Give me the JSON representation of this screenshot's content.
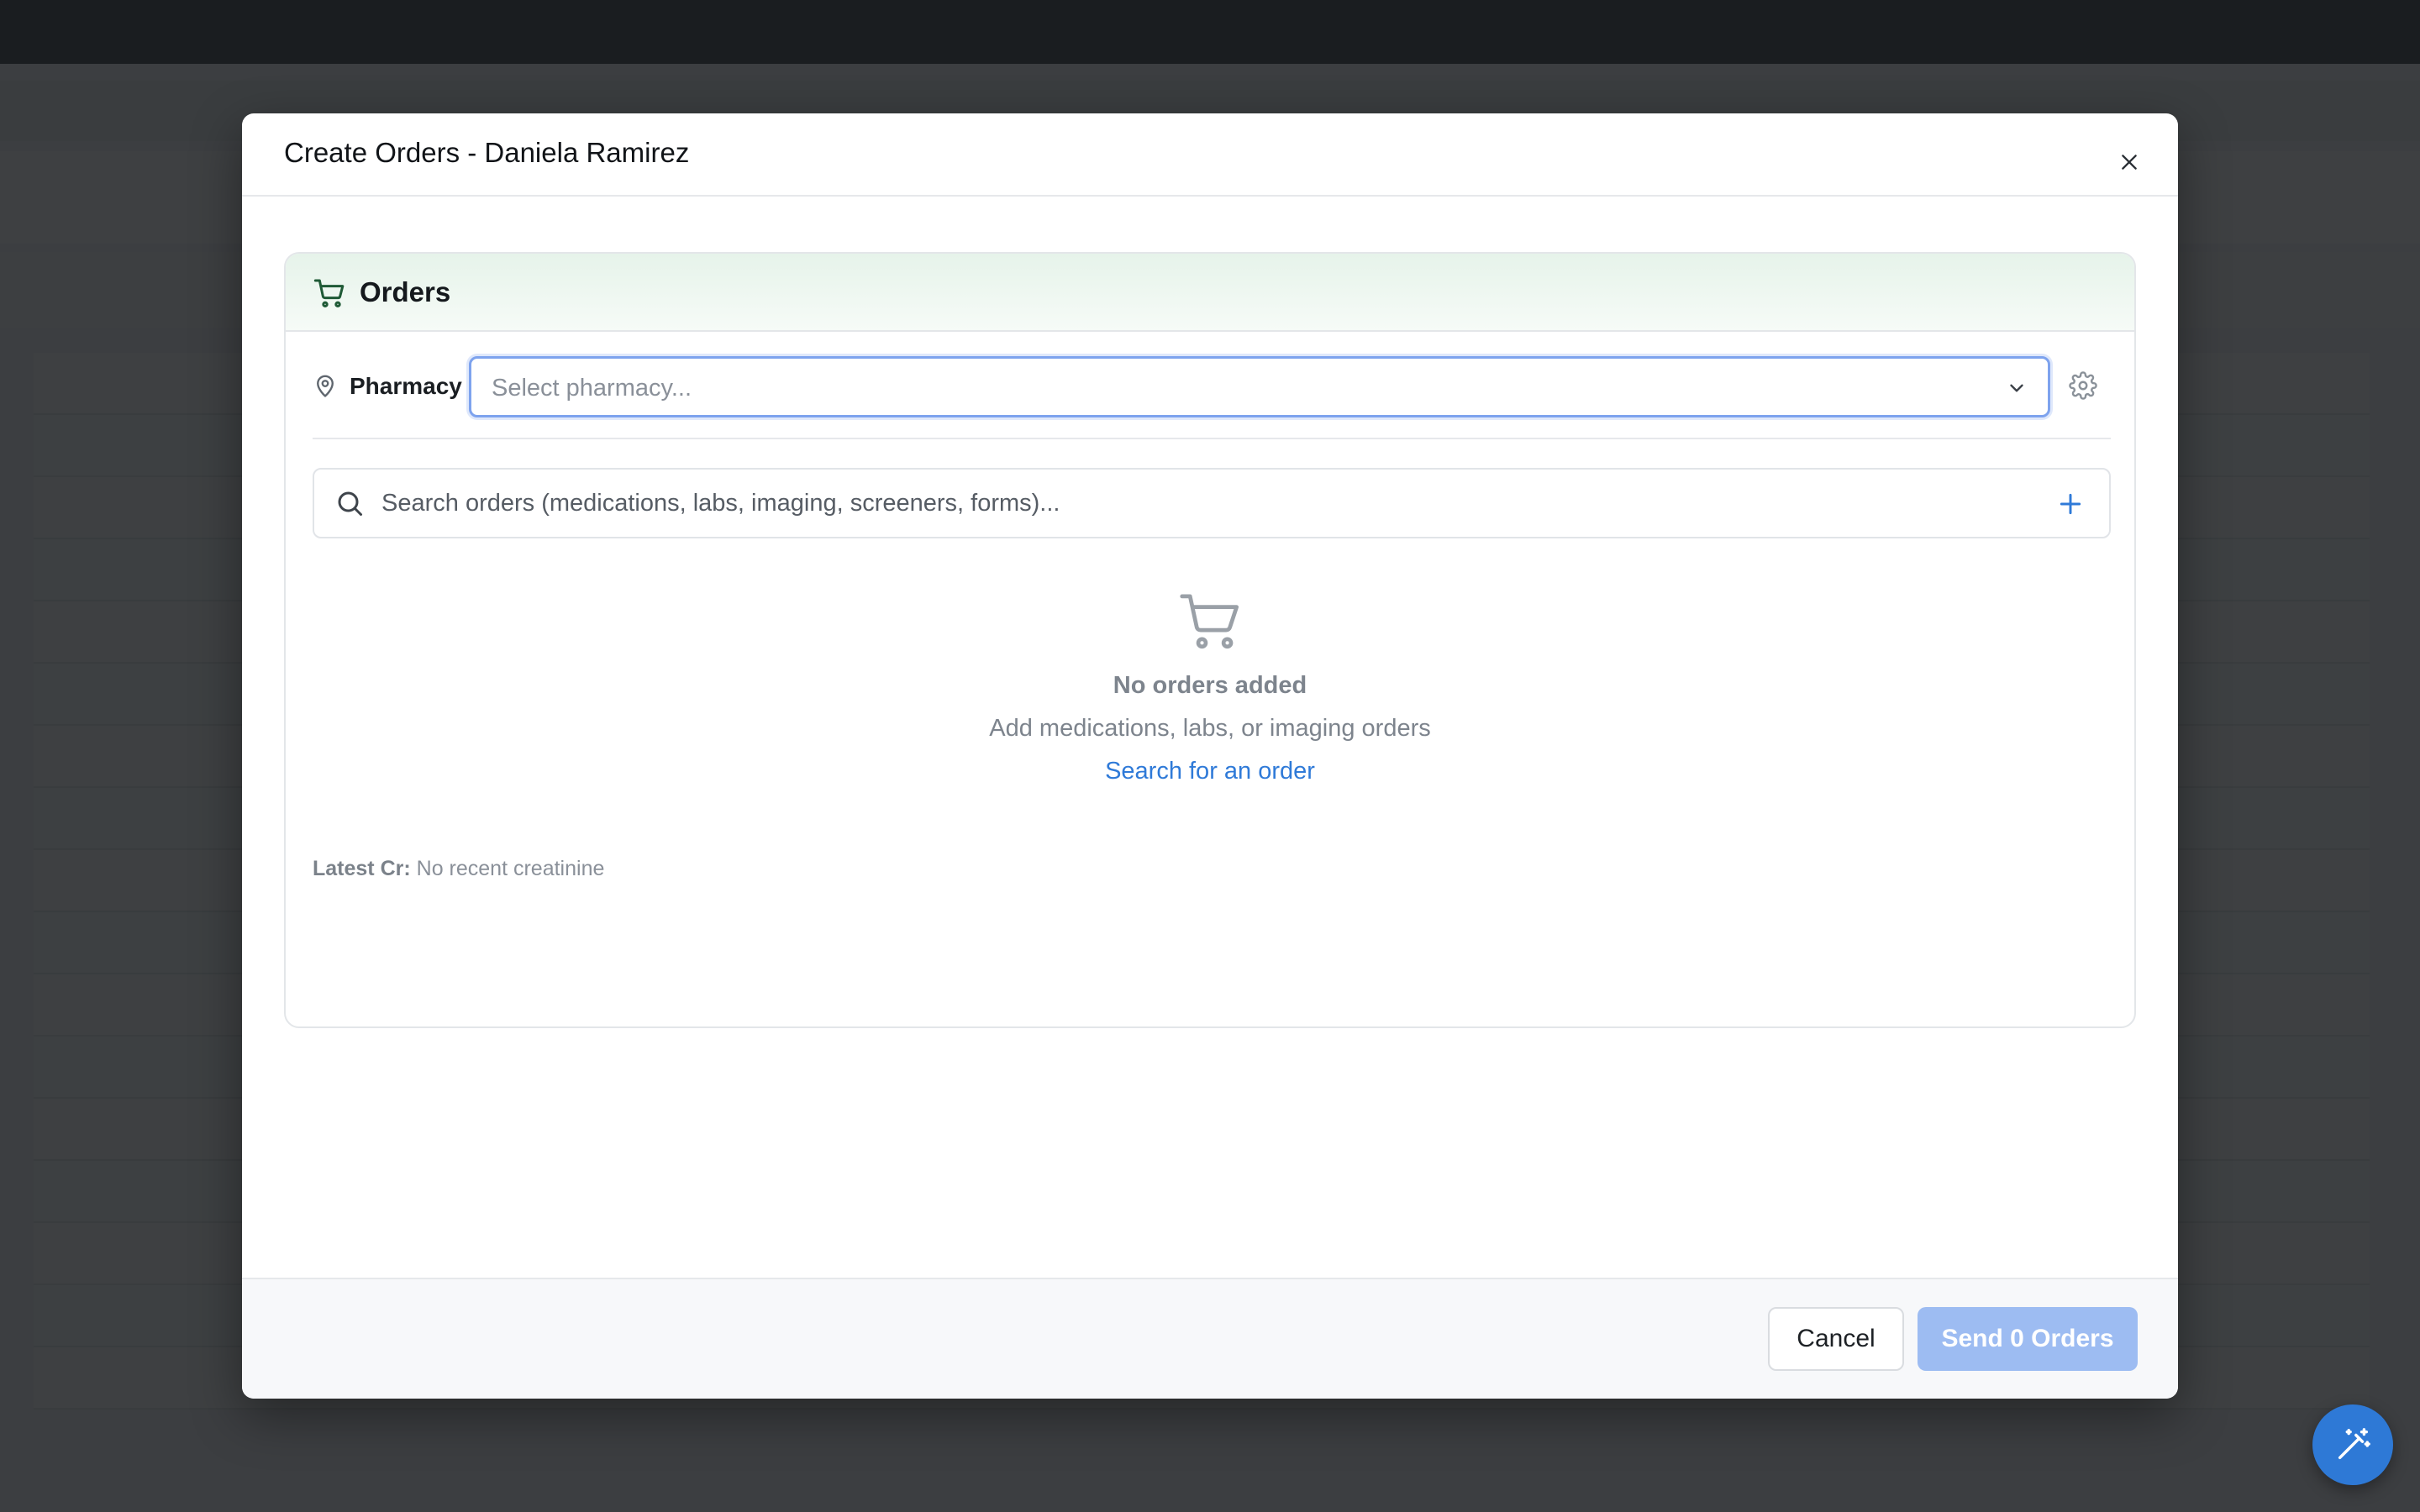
{
  "modal": {
    "title": "Create Orders - Daniela Ramirez"
  },
  "orders_card": {
    "title": "Orders",
    "pharmacy_label": "Pharmacy",
    "pharmacy_placeholder": "Select pharmacy...",
    "search_placeholder": "Search orders (medications, labs, imaging, screeners, forms)...",
    "empty_title": "No orders added",
    "empty_subtitle": "Add medications, labs, or imaging orders",
    "empty_link": "Search for an order",
    "latest_cr_label": "Latest Cr:",
    "latest_cr_value": "No recent creatinine"
  },
  "footer": {
    "cancel_label": "Cancel",
    "send_label": "Send 0 Orders"
  },
  "colors": {
    "accent": "#2f7ad8",
    "orders_header_tint": "#e6f3ea",
    "cart_icon": "#1f5a36",
    "send_disabled": "#9dbcf2",
    "fab": "#2e79d6"
  },
  "icons": {
    "close": "close-icon",
    "cart": "shopping-cart-icon",
    "pin": "map-pin-icon",
    "chevron": "chevron-down-icon",
    "gear": "gear-icon",
    "search": "search-icon",
    "plus": "plus-icon",
    "magic": "magic-wand-icon"
  }
}
